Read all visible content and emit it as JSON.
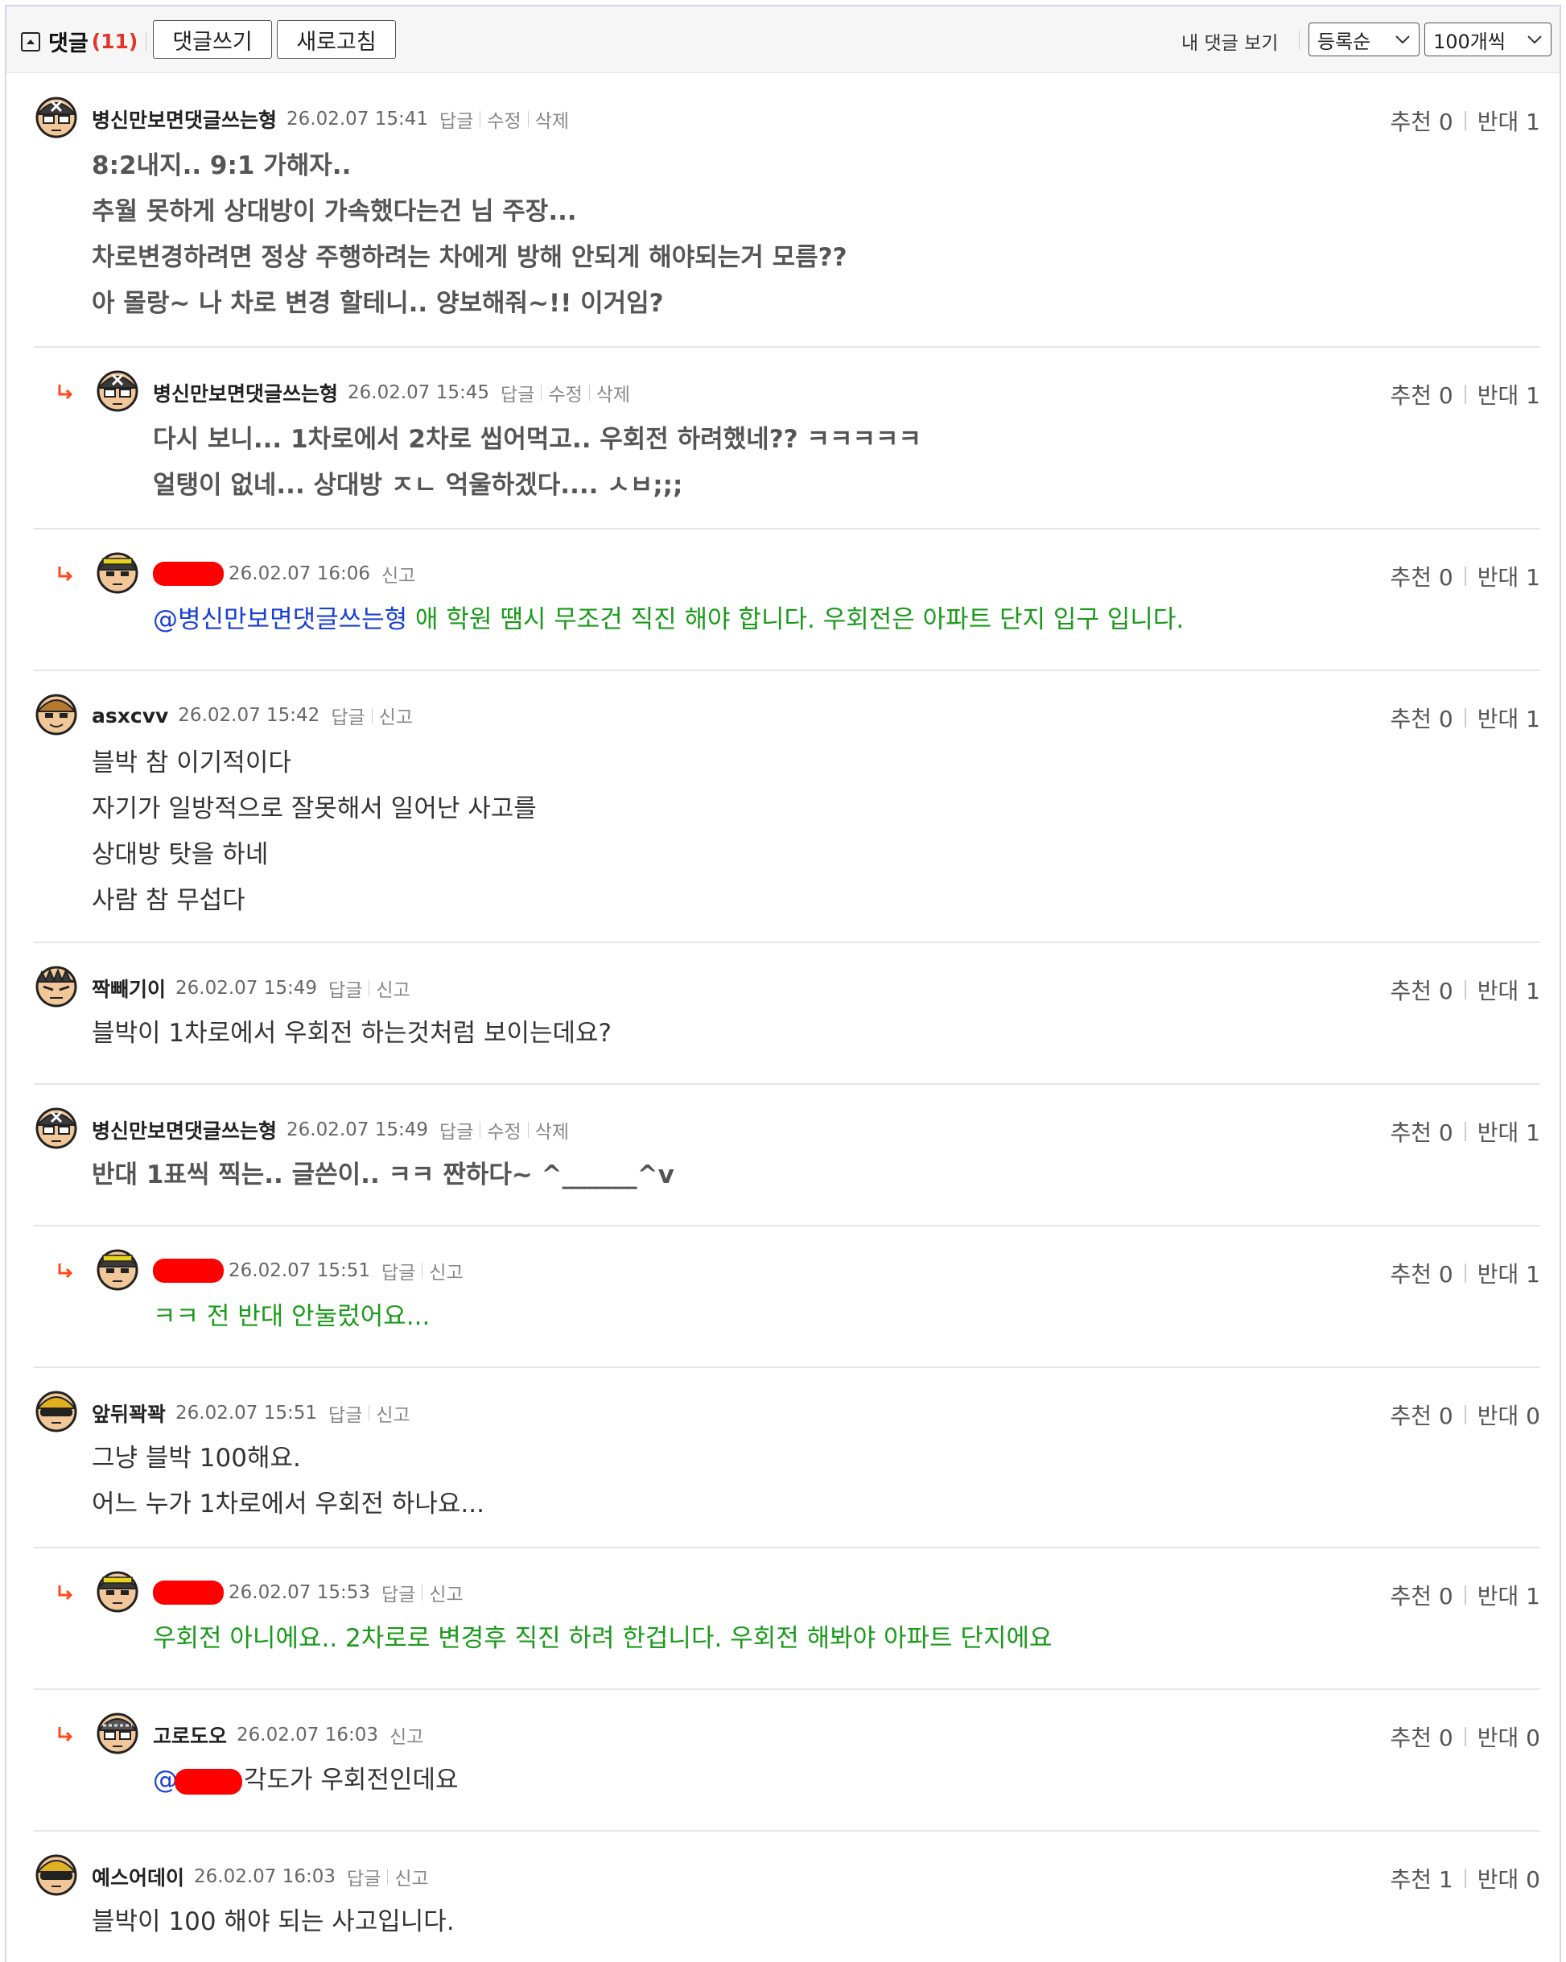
{
  "header": {
    "title": "댓글",
    "count": "(11)",
    "write_button": "댓글쓰기",
    "refresh_button": "새로고침",
    "my_comments": "내 댓글 보기",
    "sort_select": "등록순",
    "per_page_select": "100개씩"
  },
  "comments": [
    {
      "nick": "병신만보면댓글쓰는형",
      "date": "26.02.07 15:41",
      "actions": [
        "답글",
        "수정",
        "삭제"
      ],
      "up_label": "추천",
      "up": "0",
      "down_label": "반대",
      "down": "1",
      "lines": [
        "8:2내지.. 9:1 가해자..",
        "추월 못하게 상대방이 가속했다는건 님 주장...",
        "차로변경하려면 정상 주행하려는 차에게 방해 안되게 해야되는거 모름??",
        "아 몰랑~ 나 차로 변경 할테니.. 양보해줘~!! 이거임?"
      ]
    },
    {
      "nick": "병신만보면댓글쓰는형",
      "date": "26.02.07 15:45",
      "actions": [
        "답글",
        "수정",
        "삭제"
      ],
      "up_label": "추천",
      "up": "0",
      "down_label": "반대",
      "down": "1",
      "lines": [
        "다시 보니... 1차로에서 2차로 씹어먹고.. 우회전 하려했네?? ㅋㅋㅋㅋㅋ",
        "얼탱이 없네... 상대방 ㅈㄴ 억울하겠다.... ㅅㅂ;;;"
      ]
    },
    {
      "date": "26.02.07 16:06",
      "actions": [
        "신고"
      ],
      "up_label": "추천",
      "up": "0",
      "down_label": "반대",
      "down": "1",
      "mention": "@병신만보면댓글쓰는형",
      "lines": [
        " 애 학원 땜시 무조건 직진 해야 합니다. 우회전은 아파트 단지 입구 입니다."
      ]
    },
    {
      "nick": "asxcvv",
      "date": "26.02.07 15:42",
      "actions": [
        "답글",
        "신고"
      ],
      "up_label": "추천",
      "up": "0",
      "down_label": "반대",
      "down": "1",
      "lines": [
        "블박 참 이기적이다",
        "자기가 일방적으로 잘못해서 일어난 사고를",
        "상대방 탓을 하네",
        "사람 참 무섭다"
      ]
    },
    {
      "nick": "짝빼기이",
      "date": "26.02.07 15:49",
      "actions": [
        "답글",
        "신고"
      ],
      "up_label": "추천",
      "up": "0",
      "down_label": "반대",
      "down": "1",
      "lines": [
        "블박이 1차로에서 우회전 하는것처럼 보이는데요?"
      ]
    },
    {
      "nick": "병신만보면댓글쓰는형",
      "date": "26.02.07 15:49",
      "actions": [
        "답글",
        "수정",
        "삭제"
      ],
      "up_label": "추천",
      "up": "0",
      "down_label": "반대",
      "down": "1",
      "lines": [
        "반대 1표씩 찍는.. 글쓴이.. ㅋㅋ 짠하다~ ^______^v"
      ]
    },
    {
      "date": "26.02.07 15:51",
      "actions": [
        "답글",
        "신고"
      ],
      "up_label": "추천",
      "up": "0",
      "down_label": "반대",
      "down": "1",
      "lines": [
        "ㅋㅋ 전 반대 안눌렀어요..."
      ]
    },
    {
      "nick": "앞뒤꽉꽉",
      "date": "26.02.07 15:51",
      "actions": [
        "답글",
        "신고"
      ],
      "up_label": "추천",
      "up": "0",
      "down_label": "반대",
      "down": "0",
      "lines": [
        "그냥 블박 100해요.",
        "어느 누가 1차로에서 우회전 하나요..."
      ]
    },
    {
      "date": "26.02.07 15:53",
      "actions": [
        "답글",
        "신고"
      ],
      "up_label": "추천",
      "up": "0",
      "down_label": "반대",
      "down": "1",
      "lines": [
        "우회전 아니에요.. 2차로로 변경후 직진 하려 한겁니다. 우회전 해봐야 아파트 단지에요"
      ]
    },
    {
      "nick": "고로도오",
      "date": "26.02.07 16:03",
      "actions": [
        "신고"
      ],
      "up_label": "추천",
      "up": "0",
      "down_label": "반대",
      "down": "0",
      "mention": "@",
      "lines": [
        "각도가 우회전인데요"
      ]
    },
    {
      "nick": "예스어데이",
      "date": "26.02.07 16:03",
      "actions": [
        "답글",
        "신고"
      ],
      "up_label": "추천",
      "up": "1",
      "down_label": "반대",
      "down": "0",
      "lines": [
        "블박이 100 해야 되는 사고입니다."
      ]
    }
  ],
  "colors": {
    "reply_arrow": "#ff4a1c",
    "reply_text": "#1a9a1a",
    "mention": "#1a3fd6",
    "redaction": "#ff0000"
  }
}
